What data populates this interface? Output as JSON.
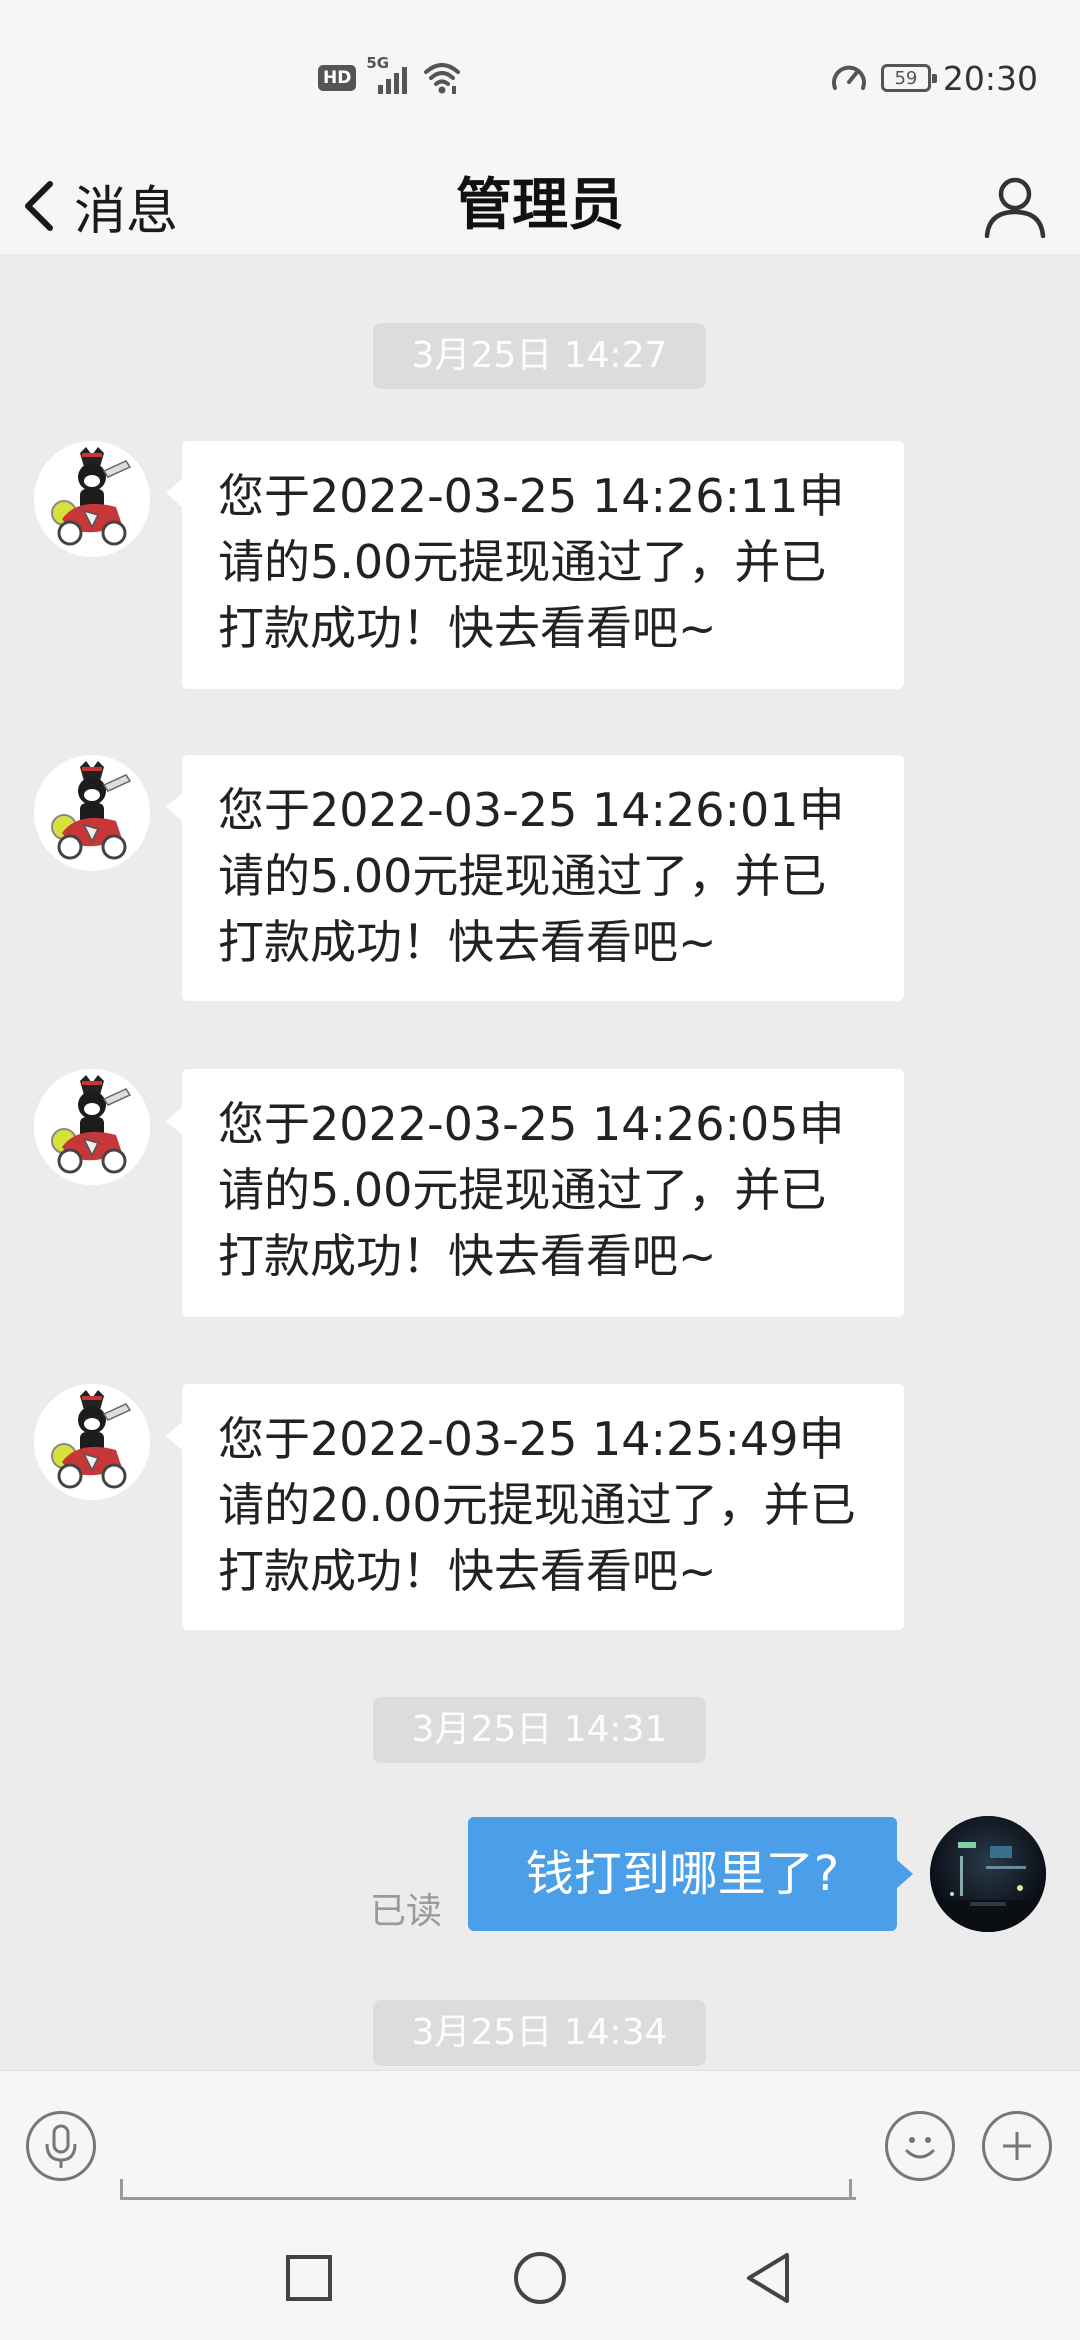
{
  "status_bar": {
    "hd": "HD",
    "network": "5G",
    "battery": "59",
    "time": "20:30"
  },
  "header": {
    "back_label": "消息",
    "title": "管理员"
  },
  "chat": {
    "timestamps": [
      "3月25日 14:27",
      "3月25日 14:31",
      "3月25日 14:34"
    ],
    "incoming": [
      {
        "text": "您于2022-03-25 14:26:11申请的5.00元提现通过了，并已打款成功！快去看看吧~"
      },
      {
        "text": "您于2022-03-25 14:26:01申请的5.00元提现通过了，并已打款成功！快去看看吧~"
      },
      {
        "text": "您于2022-03-25 14:26:05申请的5.00元提现通过了，并已打款成功！快去看看吧~"
      },
      {
        "text": "您于2022-03-25 14:25:49申请的20.00元提现通过了，并已打款成功！快去看看吧~"
      }
    ],
    "outgoing": {
      "text": "钱打到哪里了?",
      "status": "已读"
    }
  },
  "input_bar": {
    "placeholder": ""
  },
  "icons": {
    "back": "chevron-left-icon",
    "profile": "person-icon",
    "voice": "microphone-icon",
    "emoji": "smiley-icon",
    "more": "plus-icon",
    "nav_recent": "square-icon",
    "nav_home": "circle-icon",
    "nav_back": "triangle-back-icon"
  },
  "colors": {
    "accent": "#4b9fe8",
    "background": "#ececec",
    "bar": "#f6f6f6"
  }
}
